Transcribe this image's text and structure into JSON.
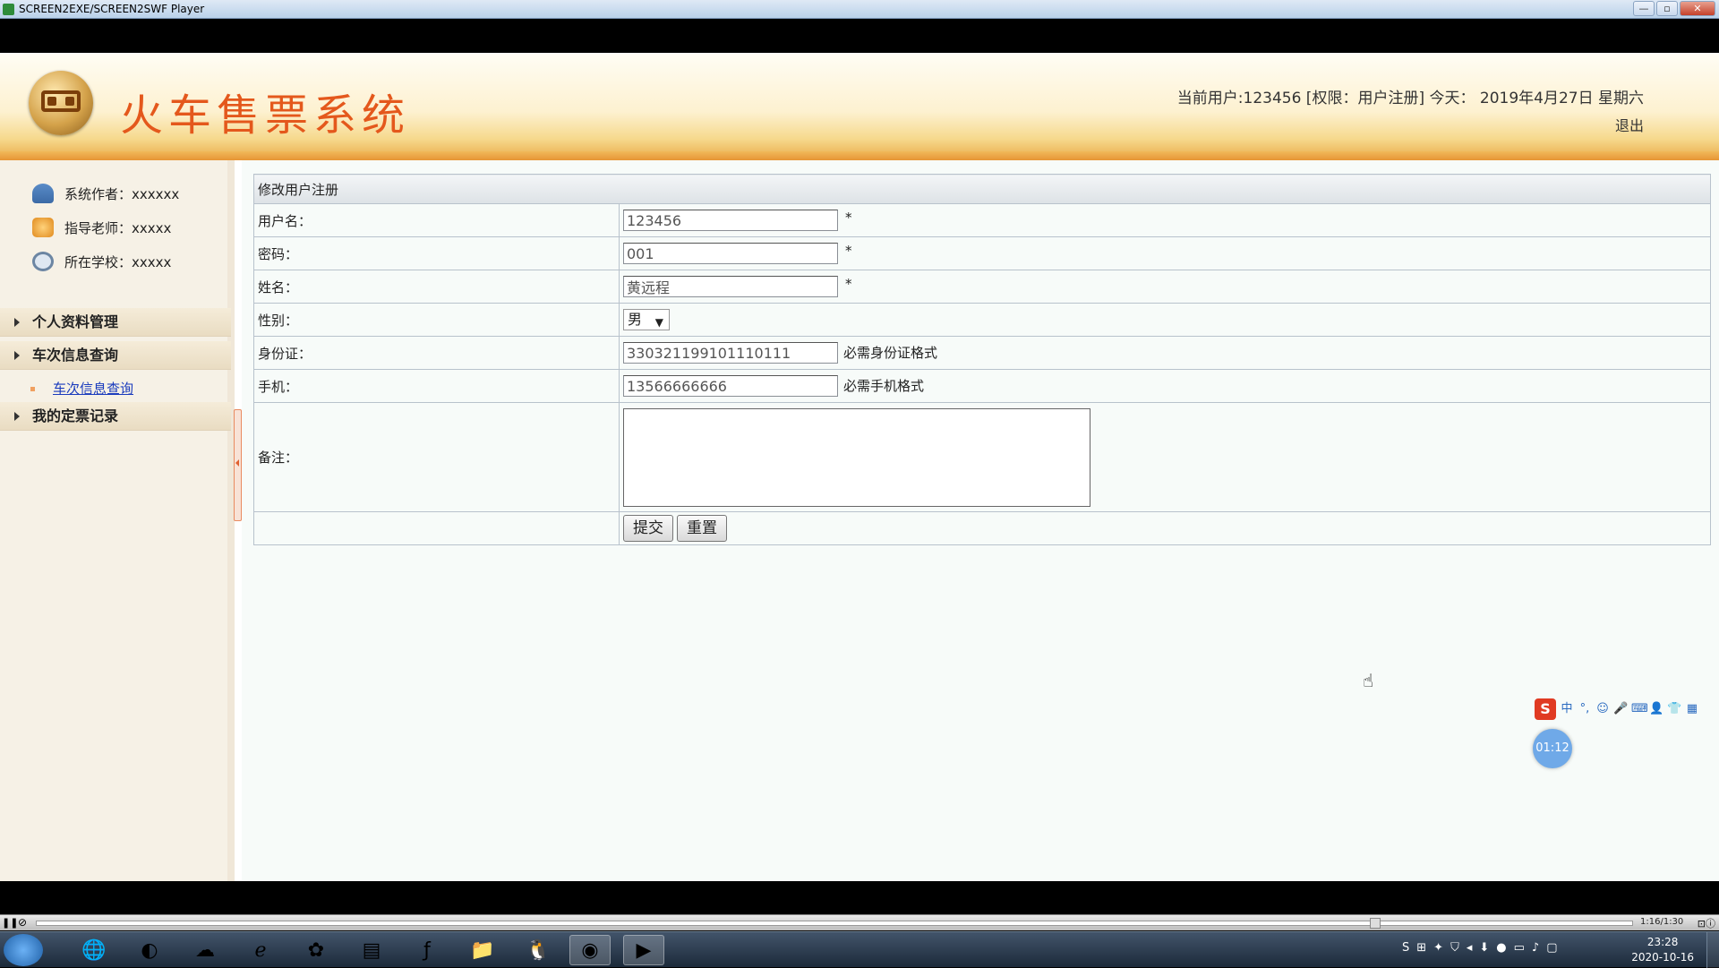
{
  "window": {
    "title": "SCREEN2EXE/SCREEN2SWF Player",
    "buttons": [
      "—",
      "▫",
      "✕"
    ]
  },
  "header": {
    "site_title": "火车售票系统",
    "user_info": "当前用户:123456 [权限：用户注册] 今天： 2019年4月27日 星期六",
    "logout": "退出"
  },
  "sidebar": {
    "info": [
      {
        "label": "系统作者：xxxxxx",
        "icon": "author-icon"
      },
      {
        "label": "指导老师：xxxxx",
        "icon": "teacher-icon"
      },
      {
        "label": "所在学校：xxxxx",
        "icon": "school-icon"
      }
    ],
    "menu": [
      {
        "label": "个人资料管理"
      },
      {
        "label": "车次信息查询"
      },
      {
        "label": "我的定票记录"
      }
    ],
    "submenu": {
      "label": "车次信息查询"
    }
  },
  "form": {
    "title": "修改用户注册",
    "username": {
      "label": "用户名：",
      "value": "123456",
      "mark": "*"
    },
    "password": {
      "label": "密码：",
      "value": "001",
      "mark": "*"
    },
    "name": {
      "label": "姓名：",
      "value": "黄远程",
      "mark": "*"
    },
    "gender": {
      "label": "性别：",
      "value": "男",
      "caret": "▼"
    },
    "idcard": {
      "label": "身份证：",
      "value": "330321199101110111",
      "hint": "必需身份证格式"
    },
    "phone": {
      "label": "手机：",
      "value": "13566666666",
      "hint": "必需手机格式"
    },
    "remark": {
      "label": "备注：",
      "value": ""
    },
    "submit": "提交",
    "reset": "重置"
  },
  "overlay": {
    "timer": "01:12",
    "ime_brand": "S",
    "ime_items": [
      "中",
      "°,",
      "☺",
      "🎤",
      "⌨",
      "👤",
      "👕",
      "▦"
    ]
  },
  "player": {
    "time": "1:16/1:30"
  },
  "taskbar": {
    "clock_time": "23:28",
    "clock_date": "2020-10-16"
  }
}
